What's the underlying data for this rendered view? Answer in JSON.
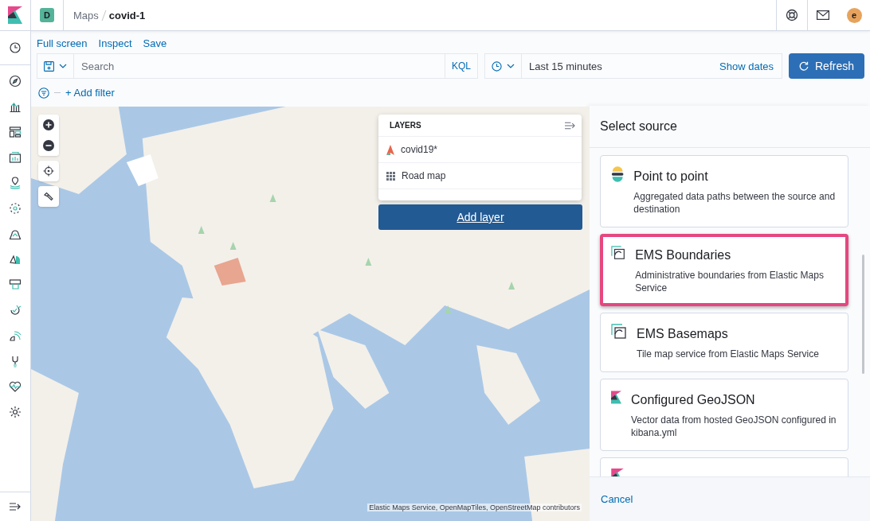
{
  "header": {
    "space_badge": "D",
    "breadcrumbs": [
      {
        "label": "Maps",
        "current": false
      },
      {
        "label": "covid-1",
        "current": true
      }
    ],
    "avatar": "e"
  },
  "top_nav": [
    "Full screen",
    "Inspect",
    "Save"
  ],
  "query_bar": {
    "placeholder": "Search",
    "language": "KQL",
    "time_range": "Last 15 minutes",
    "show_dates": "Show dates",
    "refresh": "Refresh"
  },
  "filter_bar": {
    "add_filter": "+ Add filter"
  },
  "map": {
    "kind": "picture",
    "attribution": "Elastic Maps Service, OpenMapTiles, OpenStreetMap contributors",
    "layers_panel": {
      "title": "LAYERS",
      "layers": [
        {
          "name": "covid19*",
          "kind": "points"
        },
        {
          "name": "Road map",
          "kind": "tiles"
        }
      ]
    },
    "add_layer": "Add layer"
  },
  "flyout": {
    "title": "Select source",
    "sources": [
      {
        "kind": "point_to_point",
        "title": "Point to point",
        "description": "Aggregated data paths between the source and destination",
        "highlighted": false
      },
      {
        "kind": "ems",
        "title": "EMS Boundaries",
        "description": "Administrative boundaries from Elastic Maps Service",
        "highlighted": true
      },
      {
        "kind": "ems",
        "title": "EMS Basemaps",
        "description": "Tile map service from Elastic Maps Service",
        "highlighted": false
      },
      {
        "kind": "kibana",
        "title": "Configured GeoJSON",
        "description": "Vector data from hosted GeoJSON configured in kibana.yml",
        "highlighted": false
      },
      {
        "kind": "kibana",
        "highlighted": false
      }
    ],
    "cancel": "Cancel"
  }
}
